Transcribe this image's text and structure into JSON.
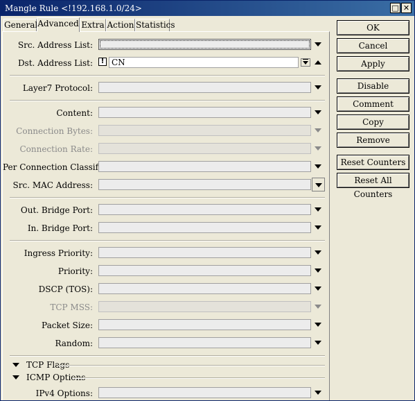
{
  "window": {
    "title": "Mangle Rule <!192.168.1.0/24>",
    "minimize_glyph": "□",
    "close_glyph": "✕"
  },
  "tabs": [
    {
      "label": "General",
      "active": false
    },
    {
      "label": "Advanced",
      "active": true
    },
    {
      "label": "Extra",
      "active": false
    },
    {
      "label": "Action",
      "active": false
    },
    {
      "label": "Statistics",
      "active": false
    }
  ],
  "fields": {
    "src_address_list": {
      "label": "Src. Address List:",
      "value": ""
    },
    "dst_address_list": {
      "label": "Dst. Address List:",
      "value": "CN",
      "not_glyph": "!"
    },
    "layer7_protocol": {
      "label": "Layer7 Protocol:",
      "value": ""
    },
    "content": {
      "label": "Content:",
      "value": ""
    },
    "connection_bytes": {
      "label": "Connection Bytes:",
      "value": ""
    },
    "connection_rate": {
      "label": "Connection Rate:",
      "value": ""
    },
    "per_connection_classifier": {
      "label": "Per Connection Classifier:",
      "value": ""
    },
    "src_mac_address": {
      "label": "Src. MAC Address:",
      "value": ""
    },
    "out_bridge_port": {
      "label": "Out. Bridge Port:",
      "value": ""
    },
    "in_bridge_port": {
      "label": "In. Bridge Port:",
      "value": ""
    },
    "ingress_priority": {
      "label": "Ingress Priority:",
      "value": ""
    },
    "priority": {
      "label": "Priority:",
      "value": ""
    },
    "dscp_tos": {
      "label": "DSCP (TOS):",
      "value": ""
    },
    "tcp_mss": {
      "label": "TCP MSS:",
      "value": ""
    },
    "packet_size": {
      "label": "Packet Size:",
      "value": ""
    },
    "random": {
      "label": "Random:",
      "value": ""
    },
    "ipv4_options": {
      "label": "IPv4 Options:",
      "value": ""
    }
  },
  "sections": {
    "tcp_flags": "TCP Flags",
    "icmp_options": "ICMP Options"
  },
  "buttons": {
    "ok": "OK",
    "cancel": "Cancel",
    "apply": "Apply",
    "disable": "Disable",
    "comment": "Comment",
    "copy": "Copy",
    "remove": "Remove",
    "reset_counters": "Reset Counters",
    "reset_all_counters": "Reset All Counters"
  }
}
